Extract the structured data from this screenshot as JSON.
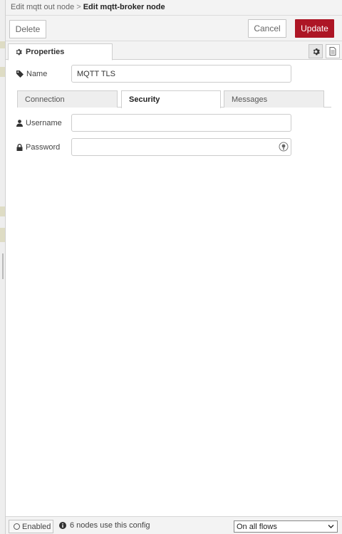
{
  "breadcrumb": {
    "previous": "Edit mqtt out node",
    "separator": ">",
    "current": "Edit mqtt-broker node"
  },
  "toolbar": {
    "delete_label": "Delete",
    "cancel_label": "Cancel",
    "update_label": "Update"
  },
  "tray_tabs": {
    "properties_label": "Properties"
  },
  "form": {
    "name_label": "Name",
    "name_value": "MQTT TLS",
    "username_label": "Username",
    "username_value": "",
    "password_label": "Password",
    "password_value": ""
  },
  "sub_tabs": [
    {
      "label": "Connection",
      "active": false
    },
    {
      "label": "Security",
      "active": true
    },
    {
      "label": "Messages",
      "active": false
    }
  ],
  "footer": {
    "enabled_label": "Enabled",
    "users_text": "6 nodes use this config",
    "scope_selected": "On all flows"
  },
  "colors": {
    "update_button": "#ad1625",
    "toolbar_bg": "#f3f3f3"
  },
  "icons": [
    "gear-icon",
    "tag-icon",
    "user-icon",
    "lock-icon",
    "eye-icon",
    "info-icon",
    "doc-icon"
  ]
}
